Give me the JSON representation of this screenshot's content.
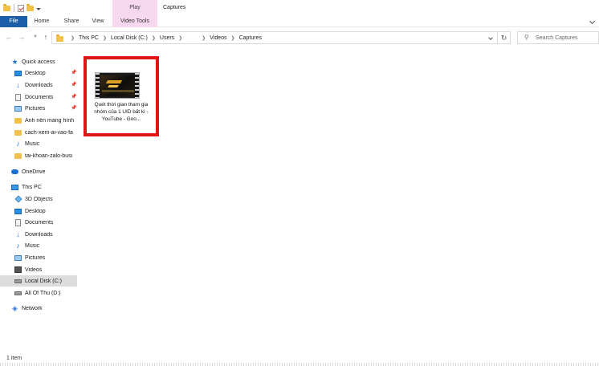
{
  "titlebar": {
    "context_tab": "Play",
    "title": "Captures"
  },
  "ribbon": {
    "tabs": {
      "file": "File",
      "home": "Home",
      "share": "Share",
      "view": "View",
      "video_tools": "Video Tools"
    },
    "colors": {
      "file_tab": "#1b5ea8",
      "context_tab": "#f8d8ef"
    }
  },
  "address": {
    "crumbs": [
      "This PC",
      "Local Disk (C:)",
      "Users",
      "",
      "Videos",
      "Captures"
    ]
  },
  "search": {
    "placeholder": "Search Captures"
  },
  "nav": {
    "quick_access": "Quick access",
    "qa_items": {
      "desktop": "Desktop",
      "downloads": "Downloads",
      "documents": "Documents",
      "pictures": "Pictures",
      "folder1": "Ảnh nền màng hình",
      "folder2": "cach-xem-ai-vao-fa",
      "music": "Music",
      "folder3": "tai-khoan-zalo-busi"
    },
    "onedrive": "OneDrive",
    "this_pc": "This PC",
    "pc_items": {
      "objects3d": "3D Objects",
      "desktop": "Desktop",
      "documents": "Documents",
      "downloads": "Downloads",
      "music": "Music",
      "pictures": "Pictures",
      "videos": "Videos",
      "local_disk": "Local Disk (C:)",
      "all_of_thu": "All Of Thu (D:)"
    },
    "network": "Network"
  },
  "content": {
    "file": {
      "name": "Quét thời gian tham gia nhóm của 1 UID bất kì - YouTube - Goo...",
      "highlight_color": "#e01515"
    }
  },
  "status": {
    "item_count": "1 item"
  }
}
